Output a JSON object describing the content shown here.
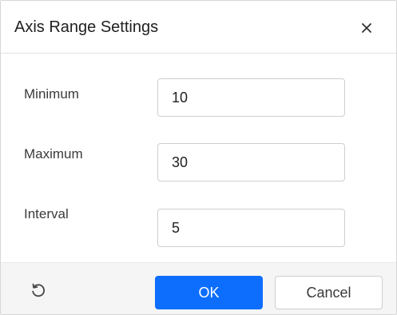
{
  "dialog": {
    "title": "Axis Range Settings",
    "close_icon": "close-icon"
  },
  "fields": {
    "minimum": {
      "label": "Minimum",
      "value": "10"
    },
    "maximum": {
      "label": "Maximum",
      "value": "30"
    },
    "interval": {
      "label": "Interval",
      "value": "5"
    }
  },
  "footer": {
    "reset_icon": "reset-icon",
    "ok_label": "OK",
    "cancel_label": "Cancel"
  },
  "colors": {
    "primary": "#0d6efd",
    "footer_bg": "#f5f5f5"
  }
}
